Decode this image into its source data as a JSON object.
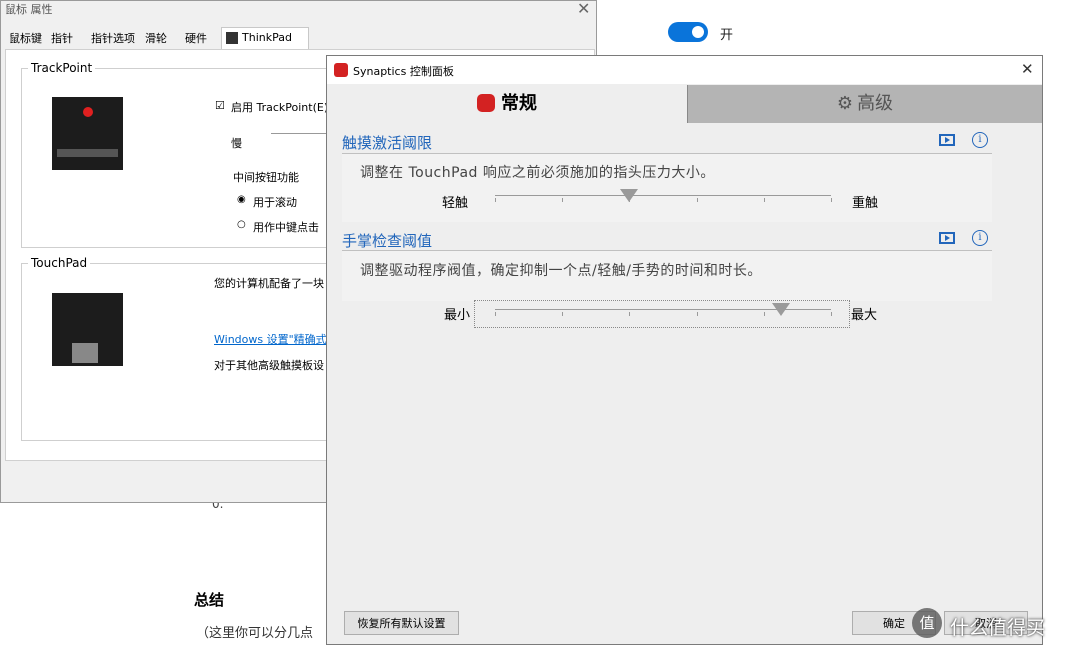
{
  "background_page": {
    "toggle_label": "开",
    "digit_text": "0.",
    "summary_heading": "总结",
    "summary_text": "（这里你可以分几点"
  },
  "mouse_properties": {
    "title": "鼠标 属性",
    "tabs": [
      "鼠标键",
      "指针",
      "指针选项",
      "滑轮",
      "硬件",
      "ThinkPad"
    ],
    "trackpoint_group": "TrackPoint",
    "enable_trackpoint": "启用 TrackPoint(E)",
    "speed_slow": "慢",
    "middle_button_function": "中间按钮功能",
    "radio_scroll": "用于滚动",
    "radio_middle_click": "用作中键点击",
    "touchpad_group": "TouchPad",
    "touchpad_desc": "您的计算机配备了一块",
    "windows_link": "Windows 设置\"精确式",
    "other_settings": "对于其他高级触摸板设"
  },
  "synaptics": {
    "title": "Synaptics 控制面板",
    "tabs": [
      "常规",
      "高级"
    ],
    "section1_title": "触摸激活阈限",
    "section1_desc": "调整在 TouchPad 响应之前必须施加的指头压力大小。",
    "section1_min": "轻触",
    "section1_max": "重触",
    "section2_title": "手掌检查阈值",
    "section2_desc": "调整驱动程序阀值，确定抑制一个点/轻触/手势的时间和时长。",
    "section2_min": "最小",
    "section2_max": "最大",
    "restore_button": "恢复所有默认设置",
    "ok_button": "确定",
    "cancel_button": "取消",
    "slider1_value": 0.4,
    "slider2_value": 0.85
  },
  "watermark": {
    "text": "什么值得买",
    "logo_glyph": "值"
  },
  "colors": {
    "accent_blue": "#2266bb",
    "brand_red": "#d32222",
    "toggle_blue": "#0a74da"
  }
}
